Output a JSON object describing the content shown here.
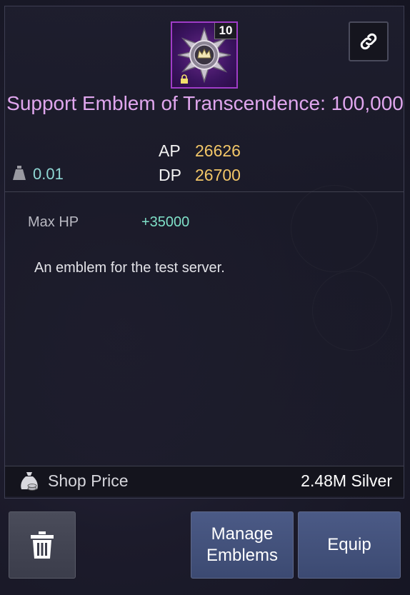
{
  "item": {
    "name": "Support Emblem of Transcendence: 100,000",
    "enhancement": "10",
    "icon": "emblem-medal-icon"
  },
  "stats": {
    "ap_label": "AP",
    "ap_value": "26626",
    "dp_label": "DP",
    "dp_value": "26700",
    "weight": "0.01"
  },
  "effects": {
    "max_hp_label": "Max HP",
    "max_hp_value": "+35000"
  },
  "description": "An emblem for the test server.",
  "shop": {
    "label": "Shop Price",
    "value": "2.48M Silver"
  },
  "buttons": {
    "manage": "Manage Emblems",
    "equip": "Equip"
  },
  "colors": {
    "title": "#e0a6ee",
    "stat_value": "#f2c668",
    "weight": "#8fd7d4",
    "bonus": "#7fe0c8",
    "button": "#4b5a86"
  }
}
